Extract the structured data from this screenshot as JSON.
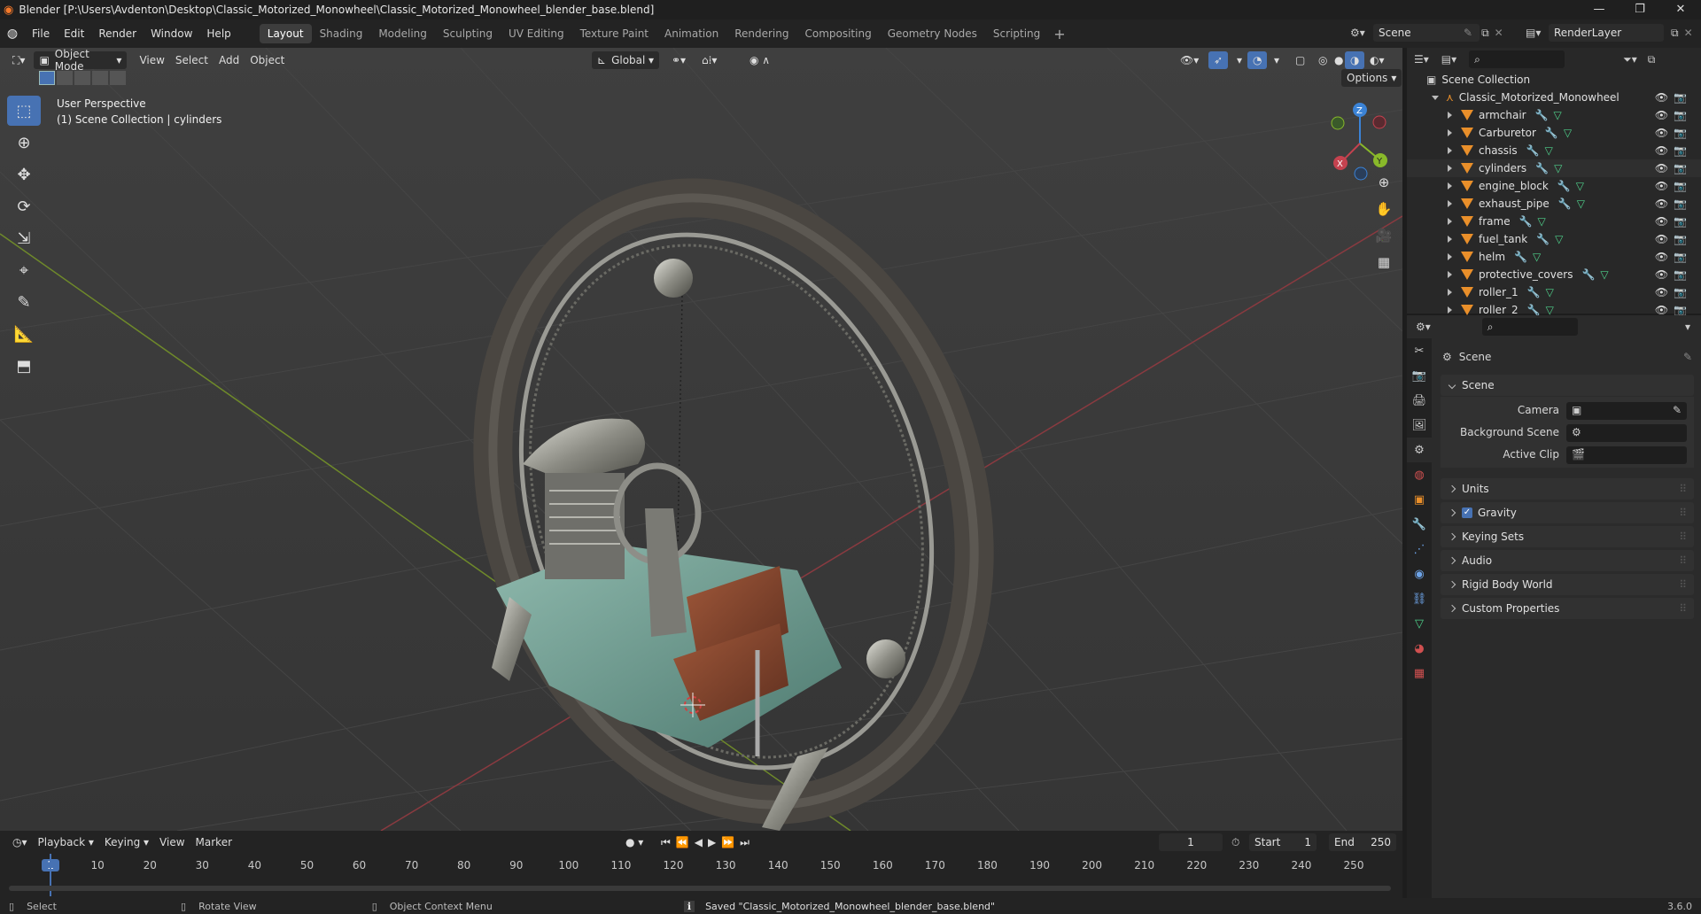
{
  "window": {
    "title": "Blender [P:\\Users\\Avdenton\\Desktop\\Classic_Motorized_Monowheel\\Classic_Motorized_Monowheel_blender_base.blend]",
    "controls": [
      "—",
      "❐",
      "✕"
    ]
  },
  "menu": [
    "File",
    "Edit",
    "Render",
    "Window",
    "Help"
  ],
  "workspaces": [
    "Layout",
    "Shading",
    "Modeling",
    "Sculpting",
    "UV Editing",
    "Texture Paint",
    "Animation",
    "Rendering",
    "Compositing",
    "Geometry Nodes",
    "Scripting"
  ],
  "active_workspace": "Layout",
  "scene_selector": {
    "value": "Scene"
  },
  "view_layer_selector": {
    "value": "RenderLayer"
  },
  "viewport_header": {
    "mode": "Object Mode",
    "menus": [
      "View",
      "Select",
      "Add",
      "Object"
    ],
    "transform_orientation": "Global",
    "options_label": "Options"
  },
  "viewport_info": {
    "line1": "User Perspective",
    "line2": "(1) Scene Collection | cylinders"
  },
  "gizmo": {
    "x": "X",
    "y": "Y",
    "z": "Z"
  },
  "outliner": {
    "root": "Scene Collection",
    "collection": "Classic_Motorized_Monowheel",
    "objects": [
      "armchair",
      "Carburetor",
      "chassis",
      "cylinders",
      "engine_block",
      "exhaust_pipe",
      "frame",
      "fuel_tank",
      "helm",
      "protective_covers",
      "roller_1",
      "roller_2"
    ]
  },
  "properties": {
    "context_title": "Scene",
    "panel_open": "Scene",
    "fields": [
      {
        "label": "Camera",
        "value": ""
      },
      {
        "label": "Background Scene",
        "value": ""
      },
      {
        "label": "Active Clip",
        "value": ""
      }
    ],
    "panels": [
      {
        "label": "Units",
        "checkbox": false
      },
      {
        "label": "Gravity",
        "checkbox": true
      },
      {
        "label": "Keying Sets",
        "checkbox": false
      },
      {
        "label": "Audio",
        "checkbox": false
      },
      {
        "label": "Rigid Body World",
        "checkbox": false
      },
      {
        "label": "Custom Properties",
        "checkbox": false
      }
    ]
  },
  "timeline": {
    "menus": [
      "Playback",
      "Keying",
      "View",
      "Marker"
    ],
    "current_frame": "1",
    "start_label": "Start",
    "start": "1",
    "end_label": "End",
    "end": "250",
    "ruler": [
      "1",
      "10",
      "20",
      "30",
      "40",
      "50",
      "60",
      "70",
      "80",
      "90",
      "100",
      "110",
      "120",
      "130",
      "140",
      "150",
      "160",
      "170",
      "180",
      "190",
      "200",
      "210",
      "220",
      "230",
      "240",
      "250"
    ]
  },
  "statusbar": {
    "select": "Select",
    "rotate": "Rotate View",
    "context": "Object Context Menu",
    "message": "Saved \"Classic_Motorized_Monowheel_blender_base.blend\"",
    "version": "3.6.0"
  },
  "colors": {
    "accent": "#4772b3",
    "object_orange": "#e98f2a",
    "x_axis": "#c5424f",
    "y_axis": "#89b92a",
    "z_axis": "#3b83d6"
  }
}
